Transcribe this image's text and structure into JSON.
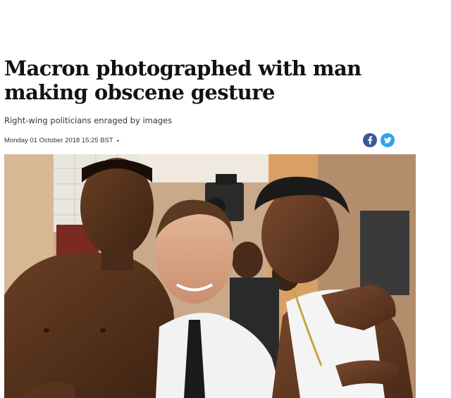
{
  "article": {
    "headline": "Macron photographed with man making obscene gesture",
    "standfirst": "Right-wing politicians enraged by images",
    "dateline": "Monday 01 October 2018 15:25 BST"
  },
  "share": {
    "facebook_icon": "facebook-icon",
    "twitter_icon": "twitter-icon",
    "facebook_color": "#3b5998",
    "twitter_color": "#2aa3ef"
  },
  "photo": {
    "subject": "news-photo"
  }
}
